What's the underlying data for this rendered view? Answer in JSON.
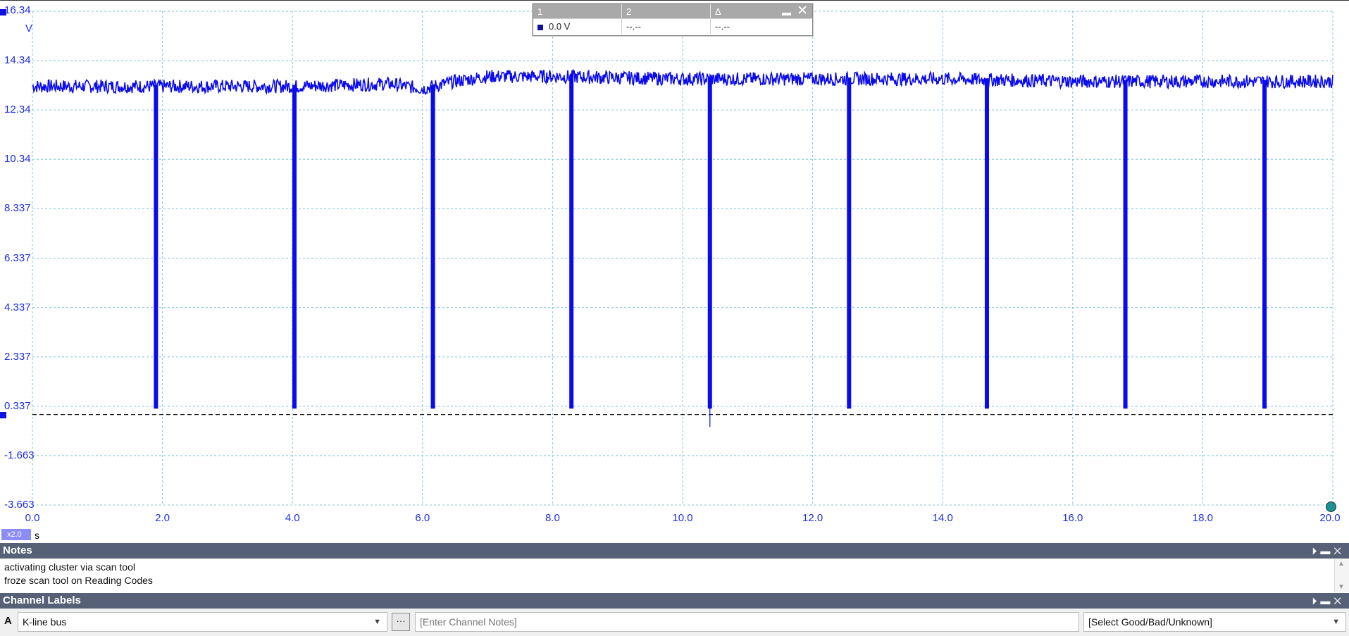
{
  "scope": {
    "y_unit": "V",
    "y_ticks": [
      "16.34",
      "14.34",
      "12.34",
      "10.34",
      "8.337",
      "6.337",
      "4.337",
      "2.337",
      "0.337",
      "-1.663",
      "-3.663"
    ],
    "x_ticks": [
      "0.0",
      "2.0",
      "4.0",
      "6.0",
      "8.0",
      "10.0",
      "12.0",
      "14.0",
      "16.0",
      "18.0",
      "20.0"
    ],
    "x_unit": "s",
    "zoom_label": "x2.0",
    "trace_color": "#0a0aee",
    "grid_color": "#7fc6dd"
  },
  "ruler": {
    "col1": "1",
    "col2": "2",
    "col_delta": "Δ",
    "value1": "0.0 V",
    "value2": "--.--",
    "value_delta": "--.--",
    "min_icon": "minimize-icon",
    "close_icon": "close-icon"
  },
  "notes": {
    "title": "Notes",
    "line1": "activating cluster via scan tool",
    "line2": "froze scan tool on Reading Codes"
  },
  "channel_labels": {
    "title": "Channel Labels",
    "channel_letter": "A",
    "channel_name": "K-line bus",
    "dots_label": "···",
    "notes_placeholder": "[Enter Channel Notes]",
    "quality_value": "[Select Good/Bad/Unknown]"
  },
  "panel_icons": {
    "pin": "pin-icon",
    "minimize": "minimize-icon",
    "close": "close-icon"
  },
  "chart_data": {
    "type": "line",
    "ylabel": "V",
    "xlabel": "s",
    "xlim": [
      0,
      20
    ],
    "ylim": [
      -3.663,
      16.34
    ],
    "grid": true,
    "series": [
      {
        "baseline_segments": [
          {
            "x": [
              0.0,
              2.0,
              4.0,
              5.5,
              6.0,
              6.5,
              7.0,
              8.0,
              10.0,
              12.0,
              14.0,
              16.0,
              18.0,
              20.0
            ],
            "y": [
              13.3,
              13.3,
              13.3,
              13.4,
              13.2,
              13.5,
              13.7,
              13.7,
              13.6,
              13.6,
              13.6,
              13.5,
              13.5,
              13.5
            ]
          }
        ],
        "dropouts_x": [
          1.9,
          4.03,
          6.16,
          8.29,
          10.42,
          12.56,
          14.68,
          16.81,
          18.95
        ],
        "dropout_low": 0.3
      }
    ],
    "reference_level": 0.0
  }
}
